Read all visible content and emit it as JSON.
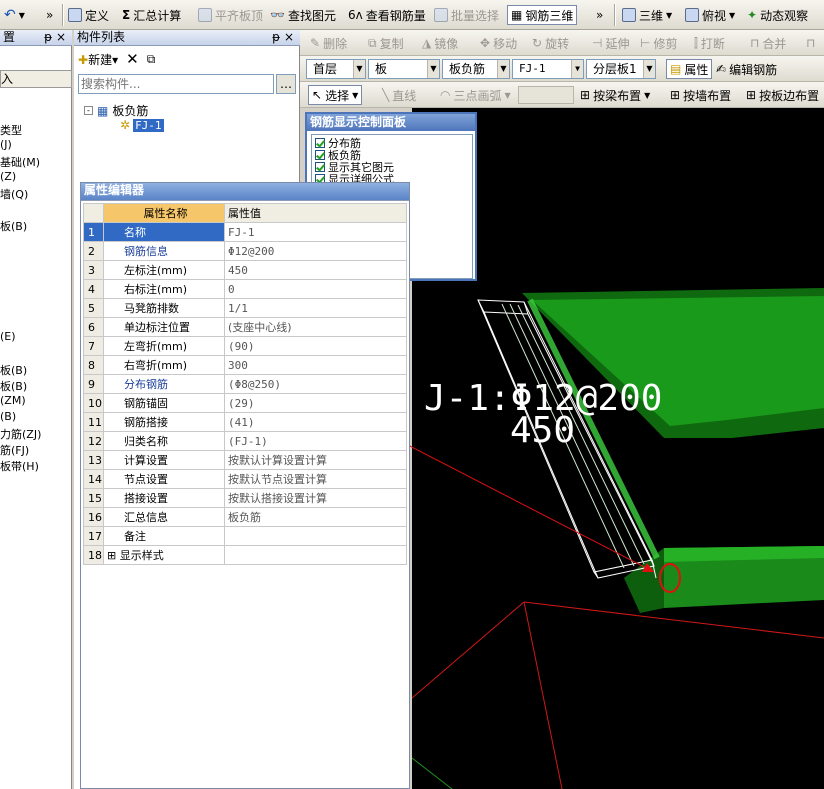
{
  "toolbar": {
    "undo": "↶",
    "define": "定义",
    "sum": "汇总计算",
    "flat_top": "平齐板顶",
    "find_elem": "查找图元",
    "view_rebar": "查看钢筋量",
    "batch_select": "批量选择",
    "rebar3d": "钢筋三维",
    "view3d": "三维",
    "top_view": "俯视",
    "dynamic_view": "动态观察"
  },
  "edit_toolbar": {
    "delete": "删除",
    "copy": "复制",
    "mirror": "镜像",
    "move": "移动",
    "rotate": "旋转",
    "extend": "延伸",
    "trim": "修剪",
    "break": "打断",
    "merge": "合并"
  },
  "combos": {
    "floor": "首层",
    "type": "板",
    "subtype": "板负筋",
    "name": "FJ-1",
    "layer": "分层板1",
    "props_btn": "属性",
    "edit_rebar_btn": "编辑钢筋"
  },
  "draw_toolbar": {
    "select": "选择",
    "line": "直线",
    "arc": "三点画弧",
    "by_beam": "按梁布置",
    "by_wall": "按墙布置",
    "by_edge": "按板边布置"
  },
  "left_panel": {
    "title": "置",
    "sub": "入",
    "items": [
      "类型",
      "(J)",
      "基础(M)",
      "(Z)",
      "墙(Q)",
      "板(B)",
      "(E)",
      "板(B)",
      "板(B)",
      "(ZM)",
      "(B)",
      "力筋(ZJ)",
      "筋(FJ)",
      "板带(H)"
    ]
  },
  "component_list": {
    "title": "构件列表",
    "new": "新建",
    "search_placeholder": "搜索构件...",
    "tree_root": "板负筋",
    "tree_child": "FJ-1"
  },
  "control_panel": {
    "title": "钢筋显示控制面板",
    "items": [
      "分布筋",
      "板负筋",
      "显示其它图元",
      "显示详细公式"
    ]
  },
  "prop_editor": {
    "title": "属性编辑器",
    "col_name": "属性名称",
    "col_value": "属性值",
    "rows": [
      {
        "n": "1",
        "k": "名称",
        "v": "FJ-1"
      },
      {
        "n": "2",
        "k": "钢筋信息",
        "v": "Φ12@200"
      },
      {
        "n": "3",
        "k": "左标注(mm)",
        "v": "450"
      },
      {
        "n": "4",
        "k": "右标注(mm)",
        "v": "0"
      },
      {
        "n": "5",
        "k": "马凳筋排数",
        "v": "1/1"
      },
      {
        "n": "6",
        "k": "单边标注位置",
        "v": "(支座中心线)"
      },
      {
        "n": "7",
        "k": "左弯折(mm)",
        "v": "(90)"
      },
      {
        "n": "8",
        "k": "右弯折(mm)",
        "v": "300"
      },
      {
        "n": "9",
        "k": "分布钢筋",
        "v": "(Φ8@250)"
      },
      {
        "n": "10",
        "k": "钢筋锚固",
        "v": "(29)"
      },
      {
        "n": "11",
        "k": "钢筋搭接",
        "v": "(41)"
      },
      {
        "n": "12",
        "k": "归类名称",
        "v": "(FJ-1)"
      },
      {
        "n": "13",
        "k": "计算设置",
        "v": "按默认计算设置计算"
      },
      {
        "n": "14",
        "k": "节点设置",
        "v": "按默认节点设置计算"
      },
      {
        "n": "15",
        "k": "搭接设置",
        "v": "按默认搭接设置计算"
      },
      {
        "n": "16",
        "k": "汇总信息",
        "v": "板负筋"
      },
      {
        "n": "17",
        "k": "备注",
        "v": ""
      },
      {
        "n": "18",
        "k": "显示样式",
        "v": ""
      }
    ]
  },
  "viewport": {
    "label1": "J-1:Φ12@200",
    "label2": "450"
  },
  "colors": {
    "green": "#1f8f1f",
    "dark_green": "#0d5f0d",
    "red": "#e01010",
    "blue_sel": "#316ac5"
  }
}
